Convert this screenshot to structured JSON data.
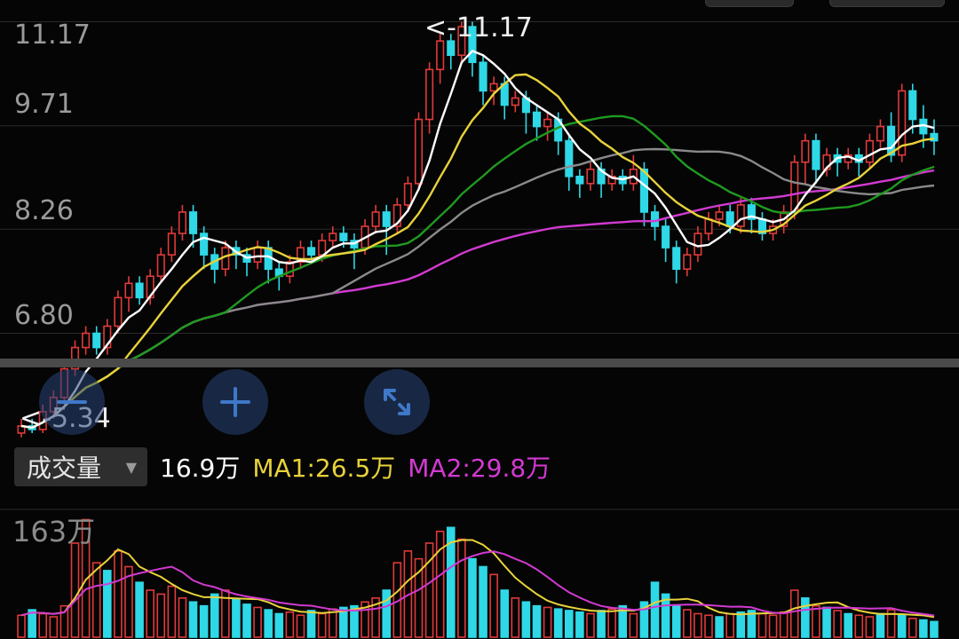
{
  "colors": {
    "up": "#e03a3a",
    "down": "#2fd8e6",
    "ma_white": "#ffffff",
    "ma_yellow": "#e8d23a",
    "ma_green": "#1f9a1f",
    "ma_gray": "#8a8a8a",
    "ma_magenta": "#d23ad2",
    "grid": "#2a2a2a"
  },
  "icons": {
    "zoom_out": "minus-icon",
    "zoom_in": "plus-icon",
    "fullscreen": "expand-icon"
  },
  "price_axis_labels": [
    "11.17",
    "9.71",
    "8.26",
    "6.80"
  ],
  "max_marker": "<-11.17",
  "min_marker": "<-5.34",
  "volume_bar": {
    "indicator": "成交量",
    "current": "16.9万",
    "ma1": "MA1:26.5万",
    "ma2": "MA2:29.8万"
  },
  "volume_axis_max": "163万",
  "chart_data": [
    {
      "type": "candlestick",
      "y_ticks": [
        11.17,
        9.71,
        8.26,
        6.8
      ],
      "ylim": [
        5.3,
        11.4
      ],
      "max_value": 11.17,
      "min_value": 5.34,
      "candles": [
        [
          5.4,
          5.5,
          5.34,
          5.6
        ],
        [
          5.5,
          5.45,
          5.4,
          5.6
        ],
        [
          5.45,
          5.7,
          5.4,
          5.8
        ],
        [
          5.7,
          5.9,
          5.6,
          6.0
        ],
        [
          5.9,
          6.3,
          5.8,
          6.4
        ],
        [
          6.3,
          6.6,
          6.2,
          6.7
        ],
        [
          6.6,
          6.8,
          6.5,
          6.9
        ],
        [
          6.8,
          6.6,
          6.5,
          6.9
        ],
        [
          6.6,
          6.9,
          6.5,
          7.0
        ],
        [
          6.9,
          7.3,
          6.8,
          7.4
        ],
        [
          7.3,
          7.5,
          7.1,
          7.6
        ],
        [
          7.5,
          7.3,
          7.2,
          7.6
        ],
        [
          7.3,
          7.6,
          7.2,
          7.7
        ],
        [
          7.6,
          7.9,
          7.5,
          8.0
        ],
        [
          7.9,
          8.2,
          7.8,
          8.3
        ],
        [
          8.2,
          8.5,
          8.1,
          8.6
        ],
        [
          8.5,
          8.2,
          8.0,
          8.6
        ],
        [
          8.2,
          7.9,
          7.7,
          8.3
        ],
        [
          7.9,
          7.7,
          7.5,
          8.0
        ],
        [
          7.7,
          8.0,
          7.6,
          8.1
        ],
        [
          8.0,
          7.9,
          7.7,
          8.1
        ],
        [
          7.9,
          7.8,
          7.6,
          8.0
        ],
        [
          7.8,
          8.0,
          7.7,
          8.1
        ],
        [
          8.0,
          7.7,
          7.5,
          8.1
        ],
        [
          7.7,
          7.6,
          7.4,
          7.8
        ],
        [
          7.6,
          7.8,
          7.5,
          7.9
        ],
        [
          7.8,
          8.0,
          7.7,
          8.1
        ],
        [
          8.0,
          7.9,
          7.8,
          8.1
        ],
        [
          7.9,
          8.1,
          7.8,
          8.2
        ],
        [
          8.1,
          8.2,
          8.0,
          8.3
        ],
        [
          8.2,
          8.1,
          8.0,
          8.3
        ],
        [
          8.1,
          8.0,
          7.7,
          8.2
        ],
        [
          8.0,
          8.3,
          7.9,
          8.4
        ],
        [
          8.3,
          8.5,
          8.2,
          8.6
        ],
        [
          8.5,
          8.3,
          7.9,
          8.6
        ],
        [
          8.3,
          8.6,
          8.2,
          8.7
        ],
        [
          8.6,
          8.9,
          8.5,
          9.0
        ],
        [
          8.9,
          9.8,
          8.8,
          9.9
        ],
        [
          9.8,
          10.5,
          9.6,
          10.6
        ],
        [
          10.5,
          10.9,
          10.3,
          11.0
        ],
        [
          10.9,
          10.7,
          10.5,
          11.0
        ],
        [
          10.7,
          11.1,
          10.6,
          11.17
        ],
        [
          11.1,
          10.6,
          10.4,
          11.17
        ],
        [
          10.6,
          10.2,
          10.0,
          10.7
        ],
        [
          10.2,
          10.3,
          10.0,
          10.4
        ],
        [
          10.3,
          10.0,
          9.8,
          10.4
        ],
        [
          10.0,
          10.1,
          9.9,
          10.2
        ],
        [
          10.1,
          9.9,
          9.6,
          10.2
        ],
        [
          9.9,
          9.7,
          9.5,
          10.0
        ],
        [
          9.7,
          9.8,
          9.5,
          9.9
        ],
        [
          9.8,
          9.5,
          9.3,
          9.9
        ],
        [
          9.5,
          9.0,
          8.8,
          9.6
        ],
        [
          9.0,
          8.9,
          8.7,
          9.1
        ],
        [
          8.9,
          9.1,
          8.8,
          9.2
        ],
        [
          9.1,
          8.9,
          8.7,
          9.2
        ],
        [
          8.9,
          9.0,
          8.8,
          9.1
        ],
        [
          9.0,
          8.9,
          8.8,
          9.1
        ],
        [
          8.9,
          9.1,
          8.8,
          9.3
        ],
        [
          9.1,
          8.5,
          8.3,
          9.2
        ],
        [
          8.5,
          8.3,
          8.1,
          8.6
        ],
        [
          8.3,
          8.0,
          7.8,
          8.4
        ],
        [
          8.0,
          7.7,
          7.5,
          8.1
        ],
        [
          7.7,
          7.9,
          7.6,
          8.0
        ],
        [
          7.9,
          8.2,
          7.8,
          8.3
        ],
        [
          8.2,
          8.4,
          8.1,
          8.5
        ],
        [
          8.4,
          8.5,
          8.3,
          8.6
        ],
        [
          8.5,
          8.3,
          8.2,
          8.6
        ],
        [
          8.3,
          8.6,
          8.2,
          8.7
        ],
        [
          8.6,
          8.4,
          8.2,
          8.7
        ],
        [
          8.4,
          8.2,
          8.1,
          8.5
        ],
        [
          8.2,
          8.3,
          8.1,
          8.4
        ],
        [
          8.3,
          8.5,
          8.2,
          8.6
        ],
        [
          8.5,
          9.2,
          8.4,
          9.3
        ],
        [
          9.2,
          9.5,
          8.9,
          9.6
        ],
        [
          9.5,
          9.1,
          8.9,
          9.6
        ],
        [
          9.1,
          9.3,
          9.0,
          9.4
        ],
        [
          9.3,
          9.2,
          9.0,
          9.4
        ],
        [
          9.2,
          9.3,
          9.1,
          9.4
        ],
        [
          9.3,
          9.2,
          9.0,
          9.4
        ],
        [
          9.2,
          9.5,
          9.1,
          9.6
        ],
        [
          9.5,
          9.7,
          9.4,
          9.8
        ],
        [
          9.7,
          9.3,
          9.2,
          9.9
        ],
        [
          9.3,
          10.2,
          9.2,
          10.3
        ],
        [
          10.2,
          9.8,
          9.6,
          10.3
        ],
        [
          9.8,
          9.6,
          9.4,
          10.0
        ],
        [
          9.6,
          9.5,
          9.3,
          9.8
        ]
      ]
    },
    {
      "type": "bar",
      "max_label": 163,
      "unit": "万",
      "values": [
        28,
        35,
        30,
        26,
        40,
        120,
        150,
        95,
        85,
        110,
        90,
        70,
        60,
        55,
        65,
        50,
        45,
        40,
        55,
        60,
        48,
        42,
        38,
        35,
        30,
        32,
        28,
        34,
        30,
        36,
        38,
        40,
        45,
        50,
        60,
        95,
        110,
        100,
        120,
        135,
        140,
        125,
        100,
        90,
        80,
        60,
        50,
        45,
        40,
        38,
        36,
        34,
        32,
        30,
        34,
        36,
        40,
        30,
        45,
        70,
        55,
        40,
        35,
        30,
        28,
        26,
        30,
        32,
        34,
        30,
        28,
        32,
        60,
        50,
        40,
        38,
        34,
        30,
        28,
        26,
        30,
        35,
        28,
        24,
        22,
        20
      ],
      "up": [
        true,
        false,
        true,
        true,
        true,
        true,
        true,
        true,
        false,
        true,
        true,
        false,
        true,
        true,
        true,
        true,
        false,
        false,
        false,
        true,
        false,
        false,
        true,
        false,
        false,
        true,
        true,
        false,
        true,
        true,
        false,
        false,
        true,
        true,
        false,
        true,
        true,
        true,
        true,
        true,
        false,
        true,
        false,
        false,
        true,
        false,
        true,
        false,
        false,
        true,
        false,
        false,
        false,
        true,
        false,
        true,
        false,
        true,
        false,
        false,
        false,
        false,
        true,
        true,
        true,
        false,
        true,
        false,
        false,
        true,
        true,
        true,
        true,
        false,
        true,
        false,
        true,
        false,
        true,
        true,
        false,
        true,
        false,
        true,
        false,
        false
      ]
    }
  ]
}
